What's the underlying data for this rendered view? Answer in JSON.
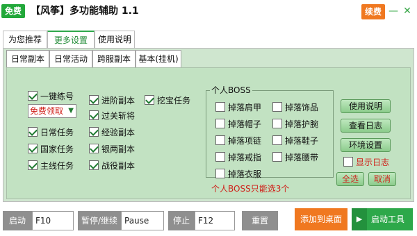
{
  "titlebar": {
    "free_badge": "免费",
    "title": "【风筝】多功能辅助 1.1",
    "renew": "续费",
    "minimize": "—",
    "close": "✕"
  },
  "main_tabs": [
    "为您推荐",
    "更多设置",
    "使用说明"
  ],
  "sub_tabs": [
    "日常副本",
    "日常活动",
    "跨服副本",
    "基本(挂机)"
  ],
  "tasks": {
    "col1": [
      {
        "label": "一键练号",
        "checked": true
      },
      {
        "label": "日常任务",
        "checked": true
      },
      {
        "label": "国家任务",
        "checked": true
      },
      {
        "label": "主线任务",
        "checked": true
      }
    ],
    "dropdown": {
      "value": "免费领取",
      "arrow": "▼"
    },
    "col2": [
      {
        "label": "进阶副本",
        "checked": true
      },
      {
        "label": "过关斩将",
        "checked": true
      },
      {
        "label": "经验副本",
        "checked": true
      },
      {
        "label": "银两副本",
        "checked": true
      },
      {
        "label": "战役副本",
        "checked": true
      }
    ],
    "col3": [
      {
        "label": "挖宝任务",
        "checked": true
      }
    ]
  },
  "boss": {
    "title": "个人BOSS",
    "left": [
      {
        "label": "掉落肩甲",
        "checked": false
      },
      {
        "label": "掉落帽子",
        "checked": false
      },
      {
        "label": "掉落项链",
        "checked": false
      },
      {
        "label": "掉落戒指",
        "checked": false
      },
      {
        "label": "掉落衣服",
        "checked": false
      }
    ],
    "right": [
      {
        "label": "掉落饰品",
        "checked": false
      },
      {
        "label": "掉落护腕",
        "checked": false
      },
      {
        "label": "掉落鞋子",
        "checked": false
      },
      {
        "label": "掉落腰带",
        "checked": false
      }
    ],
    "note": "个人BOSS只能选3个"
  },
  "side": {
    "help": "使用说明",
    "log": "查看日志",
    "env": "环境设置",
    "show_log": {
      "label": "显示日志",
      "checked": false
    },
    "select_all": "全选",
    "cancel": "取消"
  },
  "bottom": {
    "start_label": "启动",
    "start_key": "F10",
    "pause_label": "暂停/继续",
    "pause_key": "Pause",
    "stop_label": "停止",
    "stop_key": "F12",
    "reset": "重置",
    "add_desktop": "添加到桌面",
    "launch": "启动工具",
    "play_icon": "▶"
  },
  "colors": {
    "accent_green": "#2da84a",
    "accent_orange": "#f07820",
    "panel_green": "#c2e2c2",
    "warning_red": "#d0201a"
  }
}
